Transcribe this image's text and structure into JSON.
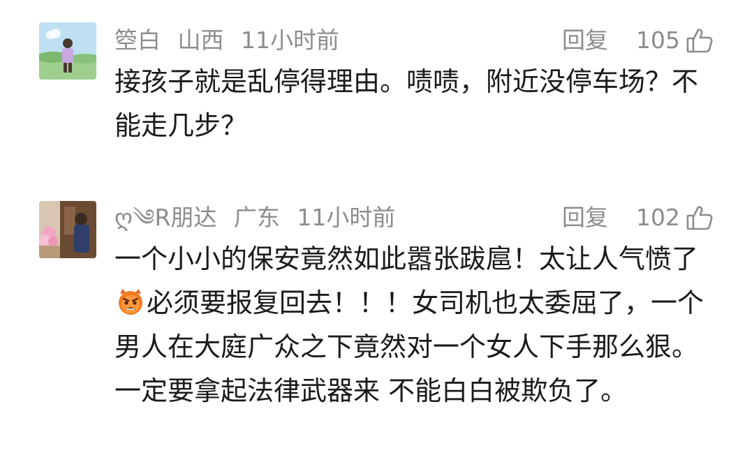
{
  "comments": [
    {
      "username": "箜白",
      "location": "山西",
      "time": "11小时前",
      "reply_label": "回复",
      "likes": "105",
      "text": "接孩子就是乱停得理由。啧啧，附近没停车场？不能走几步？"
    },
    {
      "username": "ღ༄R朋达",
      "location": "广东",
      "time": "11小时前",
      "reply_label": "回复",
      "likes": "102",
      "text_before_emoji": "一个小小的保安竟然如此嚣张跋扈！太让人气愤了",
      "emoji_icon": "angry-face-emoji",
      "text_after_emoji": "必须要报复回去！！！女司机也太委屈了，一个男人在大庭广众之下竟然对一个女人下手那么狠。一定要拿起法律武器来 不能白白被欺负了。"
    }
  ],
  "colors": {
    "meta_text": "#8c8c8c",
    "body_text": "#1a1a1a",
    "background": "#ffffff"
  }
}
